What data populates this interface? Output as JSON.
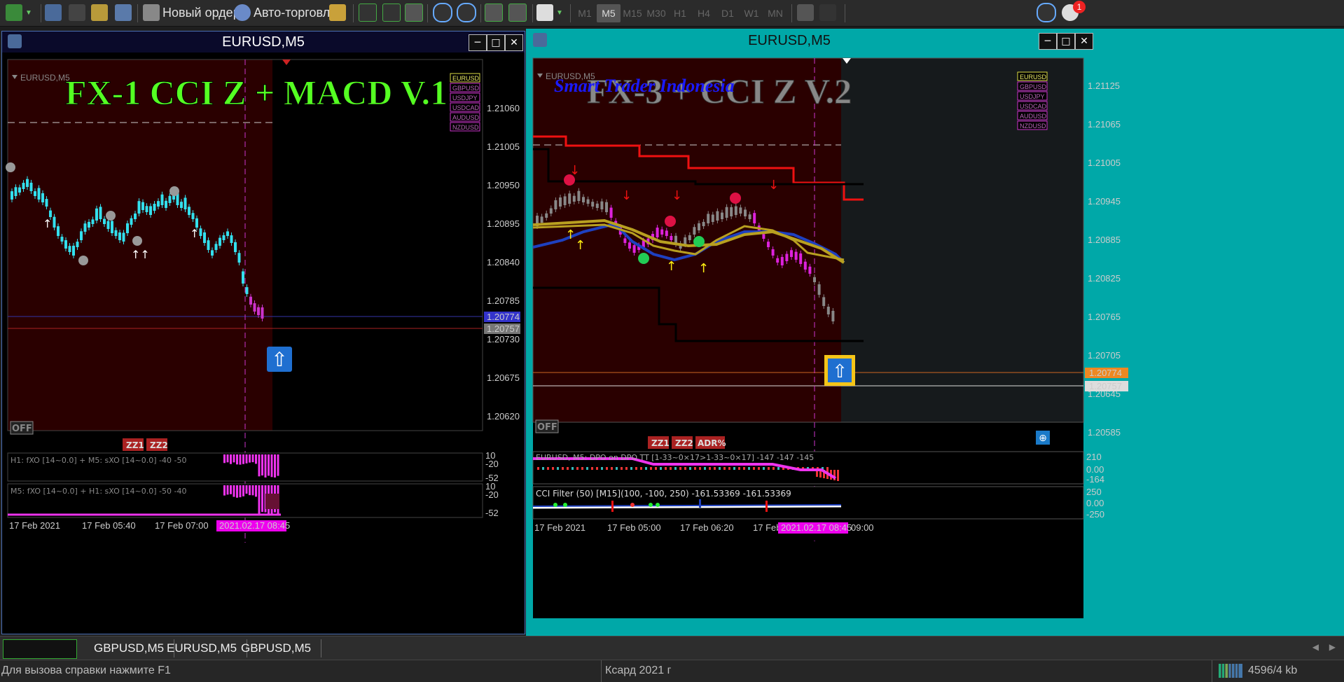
{
  "toolbar": {
    "new_order": "Новый ордер",
    "auto_trading": "Авто-торговля",
    "timeframes": [
      "M1",
      "M5",
      "M15",
      "M30",
      "H1",
      "H4",
      "D1",
      "W1",
      "MN"
    ],
    "active_timeframe": "M5",
    "notification_count": "1"
  },
  "left_chart": {
    "window_title": "EURUSD,M5",
    "symbol_label": "EURUSD,M5",
    "overlay_title": "FX-1 CCI Z + MACD V.1",
    "symbols": [
      "EURUSD",
      "GBPUSD",
      "USDJPY",
      "USDCAD",
      "AUDUSD",
      "NZDUSD"
    ],
    "price_ticks": [
      "1.21060",
      "1.21005",
      "1.20950",
      "1.20895",
      "1.20840",
      "1.20785",
      "1.20730",
      "1.20675",
      "1.20620"
    ],
    "bid_price": "1.20774",
    "ask_price": "1.20757",
    "off_label": "OFF",
    "zz_buttons": [
      "ZZ1",
      "ZZ2"
    ],
    "sub1_label": "H1: fXO [14~0.0] + M5: sXO [14~0.0]  -40 -50",
    "sub1_ticks": [
      "10",
      "-20",
      "-52"
    ],
    "sub2_label": "M5: fXO [14~0.0] + H1: sXO [14~0.0]  -50 -40",
    "sub2_ticks": [
      "10",
      "-20",
      "-52"
    ],
    "time_ticks": [
      "17 Feb 2021",
      "17 Feb 05:40",
      "17 Feb 07:00"
    ],
    "time_highlight": "2021.02.17 08:45"
  },
  "right_chart": {
    "window_title": "EURUSD,M5",
    "symbol_label": "EURUSD,M5",
    "overlay_title": "FX-3 + CCI Z V.2",
    "overlay_subtitle": "Smart Trader Indonesia",
    "symbols": [
      "EURUSD",
      "GBPUSD",
      "USDJPY",
      "USDCAD",
      "AUDUSD",
      "NZDUSD"
    ],
    "price_ticks": [
      "1.21125",
      "1.21065",
      "1.21005",
      "1.20945",
      "1.20885",
      "1.20825",
      "1.20765",
      "1.20705",
      "1.20645",
      "1.20585"
    ],
    "bid_price": "1.20774",
    "ask_price": "1.20757",
    "off_label": "OFF",
    "zz_buttons": [
      "ZZ1",
      "ZZ2",
      "ADR%"
    ],
    "sub1_label": "EURUSD, M5: DPO on DPO  TT [1-33~0×17>1-33~0×17]  -147 -147 -145",
    "sub1_ticks": [
      "210",
      "0.00",
      "-164"
    ],
    "sub2_label": "CCI Filter (50) [M15](100, -100, 250) -161.53369 -161.53369",
    "sub2_ticks": [
      "250",
      "0.00",
      "-250"
    ],
    "time_ticks": [
      "17 Feb 2021",
      "17 Feb 05:00",
      "17 Feb 06:20",
      "17 Feb"
    ],
    "time_highlight": "2021.02.17 08:45",
    "time_after": "09:00"
  },
  "tabs": [
    "GBPUSD,M5",
    "EURUSD,M5",
    "GBPUSD,M5"
  ],
  "status": {
    "help": "Для вызова справки нажмите F1",
    "profile": "Ксард 2021 г",
    "traffic": "4596/4 kb"
  },
  "colors": {
    "bull_candle": "#33e0ee",
    "bear_candle": "#cc33cc",
    "chart_bg_past": "#2a0000",
    "left_title": "#55ff22",
    "right_title": "#aaaaaa",
    "right_subtitle": "#1a1aff",
    "highlight_bg": "#ee00ee"
  }
}
